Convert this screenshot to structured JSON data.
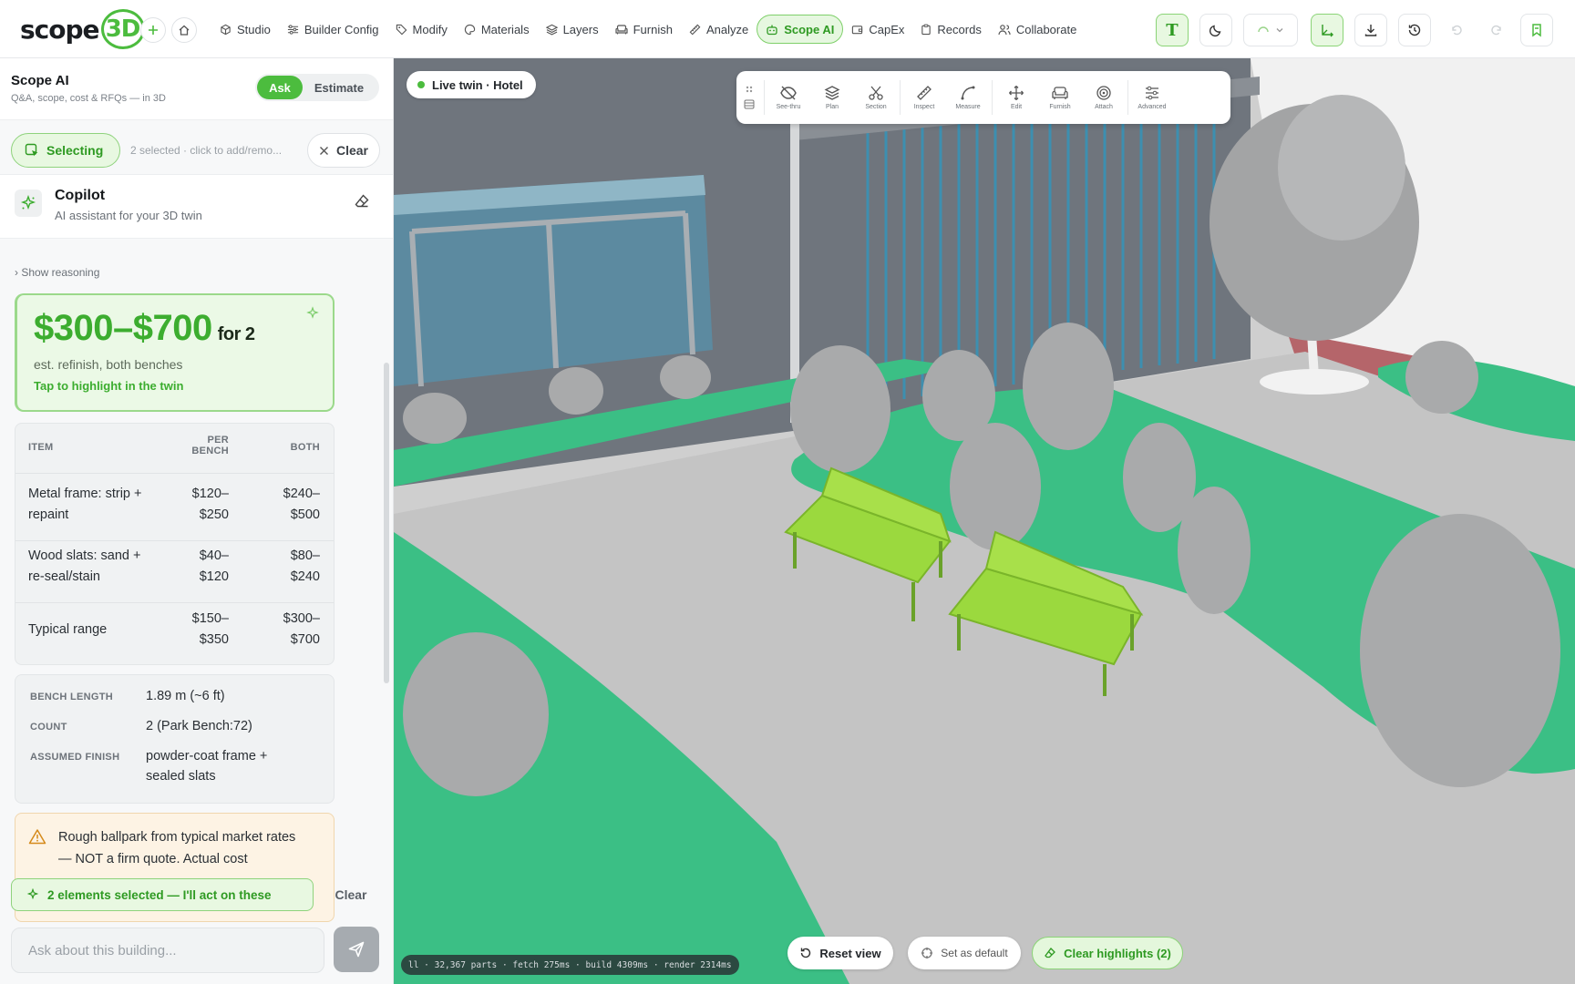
{
  "app": {
    "logo_text": "scope",
    "logo_badge": "3D"
  },
  "nav": {
    "items": [
      {
        "label": "Studio",
        "icon": "cube-icon"
      },
      {
        "label": "Builder Config",
        "icon": "sliders-icon"
      },
      {
        "label": "Modify",
        "icon": "tag-icon"
      },
      {
        "label": "Materials",
        "icon": "palette-icon"
      },
      {
        "label": "Layers",
        "icon": "layers-icon"
      },
      {
        "label": "Furnish",
        "icon": "sofa-icon"
      },
      {
        "label": "Analyze",
        "icon": "ruler-icon"
      },
      {
        "label": "Scope AI",
        "icon": "robot-icon",
        "active": true
      },
      {
        "label": "CapEx",
        "icon": "wallet-icon"
      },
      {
        "label": "Records",
        "icon": "clipboard-icon"
      },
      {
        "label": "Collaborate",
        "icon": "users-icon"
      }
    ]
  },
  "toolbar_right": {
    "text_tool": "T"
  },
  "panel": {
    "title": "Scope AI",
    "subtitle": "Q&A, scope, cost & RFQs — in 3D",
    "mode_ask": "Ask",
    "mode_estimate": "Estimate",
    "selecting_label": "Selecting",
    "selection_hint": "2 selected · click to add/remo...",
    "clear_label": "Clear",
    "copilot_title": "Copilot",
    "copilot_subtitle": "AI assistant for your 3D twin",
    "show_reasoning": "› Show reasoning"
  },
  "estimate": {
    "range": "$300–$700",
    "for_count": "for 2",
    "note": "est. refinish, both benches",
    "link": "Tap to highlight in the twin"
  },
  "cost_table": {
    "headers": {
      "item": "ITEM",
      "per_bench_1": "PER",
      "per_bench_2": "BENCH",
      "both": "BOTH"
    },
    "rows": [
      {
        "item_1": "Metal frame: strip +",
        "item_2": "repaint",
        "per_1": "$120–",
        "per_2": "$250",
        "both_1": "$240–",
        "both_2": "$500"
      },
      {
        "item_1": "Wood slats: sand +",
        "item_2": "re-seal/stain",
        "per_1": "$40–",
        "per_2": "$120",
        "both_1": "$80–",
        "both_2": "$240"
      },
      {
        "item_1": "Typical range",
        "item_2": "",
        "per_1": "$150–",
        "per_2": "$350",
        "both_1": "$300–",
        "both_2": "$700"
      }
    ]
  },
  "meta": {
    "bench_length_label": "BENCH LENGTH",
    "bench_length_value": "1.89 m (~6 ft)",
    "count_label": "COUNT",
    "count_value": "2 (Park Bench:72)",
    "finish_label": "ASSUMED FINISH",
    "finish_value_1": "powder-coat frame +",
    "finish_value_2": "sealed slats"
  },
  "warning": {
    "line_1": "Rough ballpark from typical market rates",
    "line_2": "— NOT a firm quote. Actual cost"
  },
  "action_bar": {
    "selected_text": "2 elements selected — I'll act on these",
    "clear_label": "Clear",
    "input_placeholder": "Ask about this building..."
  },
  "viewport": {
    "live_badge": "Live twin · Hotel",
    "tools": [
      {
        "label": "See-thru",
        "icon": "eye-off-icon"
      },
      {
        "label": "Plan",
        "icon": "layers-icon"
      },
      {
        "label": "Section",
        "icon": "scissors-icon"
      },
      {
        "label": "Inspect",
        "icon": "ruler-icon"
      },
      {
        "label": "Measure",
        "icon": "curve-icon"
      },
      {
        "label": "Edit",
        "icon": "move-icon"
      },
      {
        "label": "Furnish",
        "icon": "sofa-icon"
      },
      {
        "label": "Attach",
        "icon": "target-icon"
      },
      {
        "label": "Advanced",
        "icon": "sliders-icon"
      }
    ],
    "status_line": "ll · 32,367 parts · fetch 275ms · build 4309ms · render 2314ms",
    "reset_view": "Reset view",
    "set_default": "Set as default",
    "clear_highlights": "Clear highlights (2)"
  },
  "colors": {
    "accent": "#4cbc3e",
    "ground": "#3cbf86",
    "paving": "#c6c6c6",
    "highlight": "#9bd93e"
  }
}
